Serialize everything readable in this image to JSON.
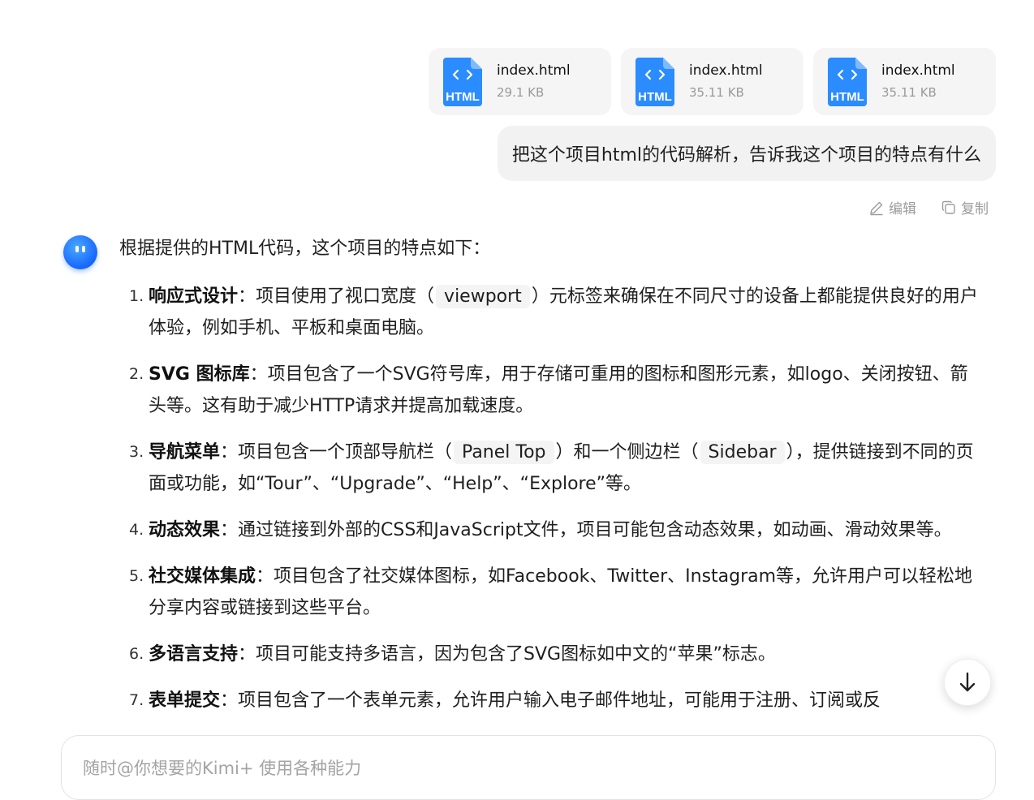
{
  "attachments": [
    {
      "name": "index.html",
      "size": "29.1 KB",
      "type_label": "HTML"
    },
    {
      "name": "index.html",
      "size": "35.11 KB",
      "type_label": "HTML"
    },
    {
      "name": "index.html",
      "size": "35.11 KB",
      "type_label": "HTML"
    }
  ],
  "user_message": "把这个项目html的代码解析，告诉我这个项目的特点有什么",
  "message_actions": {
    "edit": "编辑",
    "copy": "复制"
  },
  "answer": {
    "intro": "根据提供的HTML代码，这个项目的特点如下：",
    "points": [
      {
        "num": "1.",
        "title": "响应式设计",
        "sep": "：",
        "p1": "项目使用了视口宽度（",
        "code1": "viewport",
        "p2": "）元标签来确保在不同尺寸的设备上都能提供良好的用户体验，例如手机、平板和桌面电脑。"
      },
      {
        "num": "2.",
        "title": "SVG 图标库",
        "sep": "：",
        "p1": "项目包含了一个SVG符号库，用于存储可重用的图标和图形元素，如logo、关闭按钮、箭头等。这有助于减少HTTP请求并提高加载速度。"
      },
      {
        "num": "3.",
        "title": "导航菜单",
        "sep": "：",
        "p1": "项目包含一个顶部导航栏（",
        "code1": "Panel Top",
        "p2": "）和一个侧边栏（",
        "code2": "Sidebar",
        "p3": "），提供链接到不同的页面或功能，如“Tour”、“Upgrade”、“Help”、“Explore”等。"
      },
      {
        "num": "4.",
        "title": "动态效果",
        "sep": "：",
        "p1": "通过链接到外部的CSS和JavaScript文件，项目可能包含动态效果，如动画、滑动效果等。"
      },
      {
        "num": "5.",
        "title": "社交媒体集成",
        "sep": "：",
        "p1": "项目包含了社交媒体图标，如Facebook、Twitter、Instagram等，允许用户可以轻松地分享内容或链接到这些平台。"
      },
      {
        "num": "6.",
        "title": "多语言支持",
        "sep": "：",
        "p1": "项目可能支持多语言，因为包含了SVG图标如中文的“苹果”标志。"
      },
      {
        "num": "7.",
        "title": "表单提交",
        "sep": "：",
        "p1": "项目包含了一个表单元素，允许用户输入电子邮件地址，可能用于注册、订阅或反"
      }
    ]
  },
  "input": {
    "placeholder": "随时@你想要的Kimi+ 使用各种能力"
  },
  "colors": {
    "accent": "#1a6bff",
    "file_icon": "#2b8cff"
  }
}
